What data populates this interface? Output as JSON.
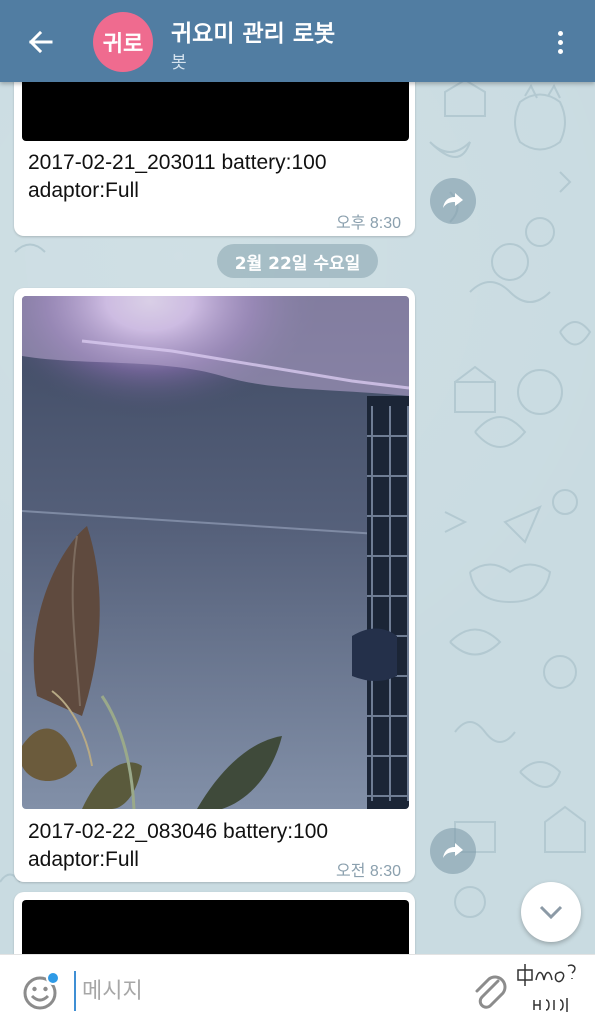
{
  "header": {
    "back_icon": "arrow-left-icon",
    "avatar_text": "귀로",
    "avatar_color": "#ef6b8f",
    "title": "귀요미 관리 로봇",
    "subtitle": "봇",
    "menu_icon": "more-vertical-icon",
    "bar_color": "#517da2"
  },
  "messages": [
    {
      "caption_line1": "2017-02-21_203011 battery:100",
      "caption_line2": "adaptor:Full",
      "time": "오후 8:30"
    },
    {
      "caption_line1": "2017-02-22_083046 battery:100",
      "caption_line2": "adaptor:Full",
      "time": "오전 8:30"
    }
  ],
  "date_separator": "2월 22일 수요일",
  "input": {
    "placeholder": "메시지",
    "value": ""
  },
  "icons": {
    "emoji": "smile-icon",
    "attach": "paperclip-icon",
    "share": "share-arrow-icon",
    "scroll_down": "chevron-down-icon"
  },
  "watermark": {
    "text": "Noni? 나니!"
  }
}
